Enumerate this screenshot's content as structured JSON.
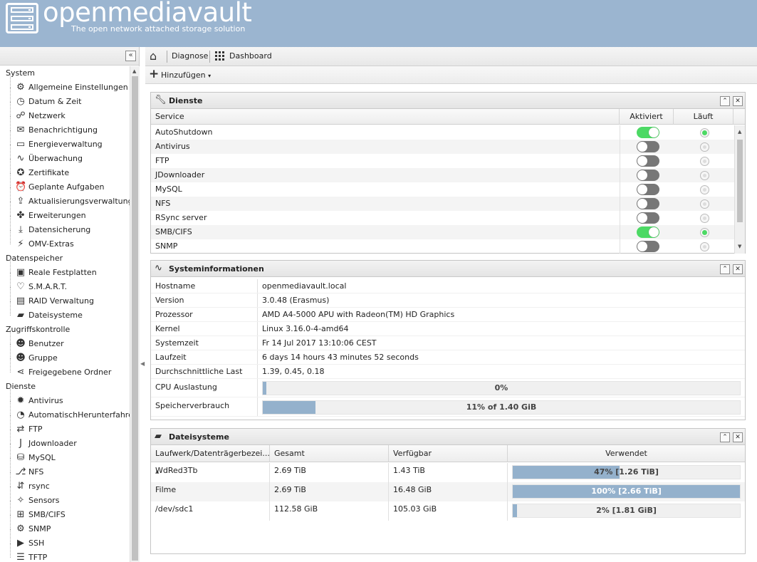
{
  "header": {
    "brand": "openmediavault",
    "tagline": "The open network attached storage solution"
  },
  "breadcrumb": {
    "items": [
      "Diagnose",
      "Dashboard"
    ]
  },
  "toolbar": {
    "add_label": "Hinzufügen"
  },
  "sidebar": {
    "collapse_label": "«",
    "groups": [
      {
        "label": "System",
        "items": [
          {
            "label": "Allgemeine Einstellungen",
            "icon": "gears-icon",
            "glyph": "⚙"
          },
          {
            "label": "Datum & Zeit",
            "icon": "clock-icon",
            "glyph": "◷"
          },
          {
            "label": "Netzwerk",
            "icon": "network-icon",
            "glyph": "☍"
          },
          {
            "label": "Benachrichtigung",
            "icon": "envelope-icon",
            "glyph": "✉"
          },
          {
            "label": "Energieverwaltung",
            "icon": "battery-icon",
            "glyph": "▭"
          },
          {
            "label": "Überwachung",
            "icon": "chart-line-icon",
            "glyph": "∿"
          },
          {
            "label": "Zertifikate",
            "icon": "certificate-icon",
            "glyph": "✪"
          },
          {
            "label": "Geplante Aufgaben",
            "icon": "alarm-clock-icon",
            "glyph": "⏰"
          },
          {
            "label": "Aktualisierungsverwaltung",
            "icon": "update-icon",
            "glyph": "⇪"
          },
          {
            "label": "Erweiterungen",
            "icon": "puzzle-icon",
            "glyph": "✤"
          },
          {
            "label": "Datensicherung",
            "icon": "download-icon",
            "glyph": "⤓"
          },
          {
            "label": "OMV-Extras",
            "icon": "plug-icon",
            "glyph": "⚡"
          }
        ]
      },
      {
        "label": "Datenspeicher",
        "items": [
          {
            "label": "Reale Festplatten",
            "icon": "hdd-icon",
            "glyph": "▣"
          },
          {
            "label": "S.M.A.R.T.",
            "icon": "heartbeat-icon",
            "glyph": "♡"
          },
          {
            "label": "RAID Verwaltung",
            "icon": "raid-icon",
            "glyph": "▤"
          },
          {
            "label": "Dateisysteme",
            "icon": "folder-icon",
            "glyph": "▰"
          }
        ]
      },
      {
        "label": "Zugriffskontrolle",
        "items": [
          {
            "label": "Benutzer",
            "icon": "user-icon",
            "glyph": "☻"
          },
          {
            "label": "Gruppe",
            "icon": "users-icon",
            "glyph": "☻"
          },
          {
            "label": "Freigegebene Ordner",
            "icon": "share-icon",
            "glyph": "⋖"
          }
        ]
      },
      {
        "label": "Dienste",
        "items": [
          {
            "label": "Antivirus",
            "icon": "bug-icon",
            "glyph": "✹"
          },
          {
            "label": "AutomatischHerunterfahren",
            "icon": "power-clock-icon",
            "glyph": "◔"
          },
          {
            "label": "FTP",
            "icon": "ftp-icon",
            "glyph": "⇄"
          },
          {
            "label": "Jdownloader",
            "icon": "jdownloader-icon",
            "glyph": "J"
          },
          {
            "label": "MySQL",
            "icon": "database-icon",
            "glyph": "⛁"
          },
          {
            "label": "NFS",
            "icon": "nfs-icon",
            "glyph": "⎇"
          },
          {
            "label": "rsync",
            "icon": "rsync-icon",
            "glyph": "⇵"
          },
          {
            "label": "Sensors",
            "icon": "sensor-icon",
            "glyph": "✧"
          },
          {
            "label": "SMB/CIFS",
            "icon": "windows-icon",
            "glyph": "⊞"
          },
          {
            "label": "SNMP",
            "icon": "snmp-icon",
            "glyph": "⚙"
          },
          {
            "label": "SSH",
            "icon": "terminal-icon",
            "glyph": "▶"
          },
          {
            "label": "TFTP",
            "icon": "tftp-icon",
            "glyph": "☰"
          }
        ]
      }
    ]
  },
  "services": {
    "title": "Dienste",
    "columns": [
      "Service",
      "Aktiviert",
      "Läuft"
    ],
    "rows": [
      {
        "name": "AutoShutdown",
        "enabled": true,
        "running": true
      },
      {
        "name": "Antivirus",
        "enabled": false,
        "running": false
      },
      {
        "name": "FTP",
        "enabled": false,
        "running": false
      },
      {
        "name": "JDownloader",
        "enabled": false,
        "running": false
      },
      {
        "name": "MySQL",
        "enabled": false,
        "running": false
      },
      {
        "name": "NFS",
        "enabled": false,
        "running": false
      },
      {
        "name": "RSync server",
        "enabled": false,
        "running": false
      },
      {
        "name": "SMB/CIFS",
        "enabled": true,
        "running": true
      },
      {
        "name": "SNMP",
        "enabled": false,
        "running": false
      }
    ]
  },
  "sysinfo": {
    "title": "Systeminformationen",
    "rows": [
      {
        "key": "Hostname",
        "value": "openmediavault.local"
      },
      {
        "key": "Version",
        "value": "3.0.48 (Erasmus)"
      },
      {
        "key": "Prozessor",
        "value": "AMD A4-5000 APU with Radeon(TM) HD Graphics"
      },
      {
        "key": "Kernel",
        "value": "Linux 3.16.0-4-amd64"
      },
      {
        "key": "Systemzeit",
        "value": "Fr 14 Jul 2017 13:10:06 CEST"
      },
      {
        "key": "Laufzeit",
        "value": "6 days 14 hours 43 minutes 52 seconds"
      },
      {
        "key": "Durchschnittliche Last",
        "value": "1.39, 0.45, 0.18"
      }
    ],
    "cpu": {
      "key": "CPU Auslastung",
      "label": "0%",
      "fraction": 0.0
    },
    "memory": {
      "key": "Speicherverbrauch",
      "label": "11% of 1.40 GiB",
      "fraction": 0.11
    }
  },
  "filesystems": {
    "title": "Dateisysteme",
    "columns": [
      "Laufwerk/Datenträgerbezei...",
      "Gesamt",
      "Verfügbar",
      "Verwendet"
    ],
    "rows": [
      {
        "device": "WdRed3Tb",
        "total": "2.69 TiB",
        "available": "1.43 TiB",
        "used_label": "47% [1.26 TiB]",
        "fraction": 0.47
      },
      {
        "device": "Filme",
        "total": "2.69 TiB",
        "available": "16.48 GiB",
        "used_label": "100% [2.66 TiB]",
        "fraction": 1.0
      },
      {
        "device": "/dev/sdc1",
        "total": "112.58 GiB",
        "available": "105.03 GiB",
        "used_label": "2% [1.81 GiB]",
        "fraction": 0.02
      }
    ]
  }
}
